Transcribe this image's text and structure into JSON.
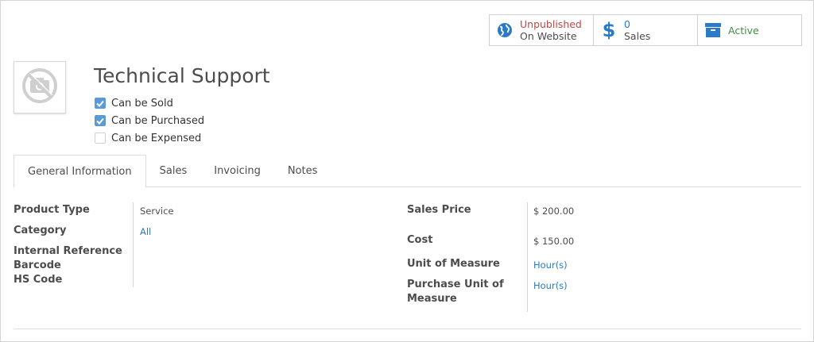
{
  "smart_buttons": {
    "website": {
      "line1": "Unpublished",
      "line2": "On Website"
    },
    "sales": {
      "count": "0",
      "label": "Sales"
    },
    "active": {
      "label": "Active"
    }
  },
  "product": {
    "name": "Technical Support",
    "checkboxes": [
      {
        "label": "Can be Sold",
        "checked": true
      },
      {
        "label": "Can be Purchased",
        "checked": true
      },
      {
        "label": "Can be Expensed",
        "checked": false
      }
    ]
  },
  "tabs": [
    "General Information",
    "Sales",
    "Invoicing",
    "Notes"
  ],
  "fields_left": {
    "product_type": {
      "label": "Product Type",
      "value": "Service"
    },
    "category": {
      "label": "Category",
      "value": "All"
    },
    "internal_reference": {
      "label": "Internal Reference"
    },
    "barcode": {
      "label": "Barcode"
    },
    "hs_code": {
      "label": "HS Code"
    }
  },
  "fields_right": {
    "sales_price": {
      "label": "Sales Price",
      "value": "$ 200.00"
    },
    "cost": {
      "label": "Cost",
      "value": "$ 150.00"
    },
    "uom": {
      "label": "Unit of Measure",
      "value": "Hour(s)"
    },
    "purchase_uom": {
      "label_l1": "Purchase Unit of",
      "label_l2": "Measure",
      "value": "Hour(s)"
    }
  },
  "colors": {
    "link": "#2a7ac9",
    "unpublished": "#b94a48",
    "active": "#3f8f3f",
    "checkbox": "#5b9bd5"
  }
}
